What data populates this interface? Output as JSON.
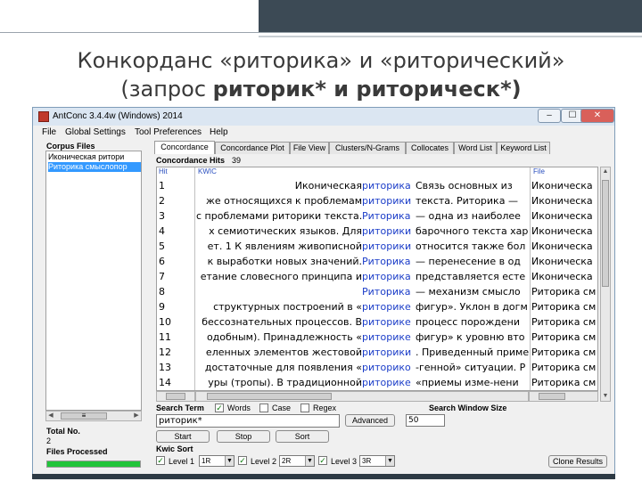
{
  "slide": {
    "title_line1": "Конкорданс «риторика» и «риторический»",
    "title_line2_prefix": "(запрос ",
    "title_line2_bold": "риторик* и риторическ*)"
  },
  "window": {
    "title": "AntConc 3.4.4w (Windows) 2014",
    "minimize": "–",
    "maximize": "☐",
    "close": "✕"
  },
  "menu": [
    "File",
    "Global Settings",
    "Tool Preferences",
    "Help"
  ],
  "left_panel": {
    "corpus_files_label": "Corpus Files",
    "files": [
      "Иконическая ритори",
      "Риторика смыслопор"
    ],
    "total_no_label": "Total No.",
    "total_no_value": "2",
    "files_processed_label": "Files Processed",
    "progress_percent": 100
  },
  "tabs": [
    "Concordance",
    "Concordance Plot",
    "File View",
    "Clusters/N-Grams",
    "Collocates",
    "Word List",
    "Keyword List"
  ],
  "concordance": {
    "hits_label": "Concordance Hits",
    "hits_value": "39",
    "col_hit": "Hit",
    "col_kwic": "KWIC",
    "col_file": "File",
    "rows": [
      {
        "n": "1",
        "left": "Иконическая",
        "kw": "риторика",
        "right": " Связь основных из",
        "file": "Иконическа"
      },
      {
        "n": "2",
        "left": "же относящихся к проблемам",
        "kw": "риторики",
        "right": " текста. Риторика —",
        "file": "Иконическа"
      },
      {
        "n": "3",
        "left": "с проблемами риторики текста.",
        "kw": "Риторика",
        "right": " — одна из наиболее",
        "file": "Иконическа"
      },
      {
        "n": "4",
        "left": "х семиотических языков. Для",
        "kw": "риторики",
        "right": " барочного текста хар",
        "file": "Иконическа"
      },
      {
        "n": "5",
        "left": "ет. 1 К явлениям живописной",
        "kw": "риторики",
        "right": " относится также бол",
        "file": "Иконическа"
      },
      {
        "n": "6",
        "left": "к выработки новых значений.",
        "kw": "Риторика",
        "right": " — перенесение в од",
        "file": "Иконическа"
      },
      {
        "n": "7",
        "left": "етание словесного принципа и",
        "kw": "риторика",
        "right": " представляется есте",
        "file": "Иконическа"
      },
      {
        "n": "8",
        "left": "",
        "kw": "Риторика",
        "right": " — механизм смысло",
        "file": "Риторика см"
      },
      {
        "n": "9",
        "left": "структурных построений в «",
        "kw": "риторике",
        "right": " фигур». Уклон в догм",
        "file": "Риторика см"
      },
      {
        "n": "10",
        "left": "бессознательных процессов. В",
        "kw": "риторике",
        "right": " процесс порождени",
        "file": "Риторика см"
      },
      {
        "n": "11",
        "left": "одобным). Принадлежность «",
        "kw": "риторике",
        "right": " фигур» к уровню вто",
        "file": "Риторика см"
      },
      {
        "n": "12",
        "left": "еленных элементов жестовой",
        "kw": "риторики",
        "right": ". Приведенный приме",
        "file": "Риторика см"
      },
      {
        "n": "13",
        "left": "достаточные для появления «",
        "kw": "риторико",
        "right": "-генной» ситуации. Р",
        "file": "Риторика см"
      },
      {
        "n": "14",
        "left": "уры (тропы). В традиционной",
        "kw": "риторике",
        "right": " «приемы изме-нени",
        "file": "Риторика см"
      }
    ]
  },
  "search": {
    "search_term_label": "Search Term",
    "words_label": "Words",
    "case_label": "Case",
    "regex_label": "Regex",
    "words_checked": true,
    "case_checked": false,
    "regex_checked": false,
    "term_value": "риторик*",
    "advanced_label": "Advanced",
    "window_size_label": "Search Window Size",
    "window_size_value": "50",
    "start_label": "Start",
    "stop_label": "Stop",
    "sort_label": "Sort",
    "kwic_sort_label": "Kwic Sort",
    "level1_label": "Level 1",
    "level1_value": "1R",
    "level2_label": "Level 2",
    "level2_value": "2R",
    "level3_label": "Level 3",
    "level3_value": "3R",
    "clone_label": "Clone Results"
  }
}
